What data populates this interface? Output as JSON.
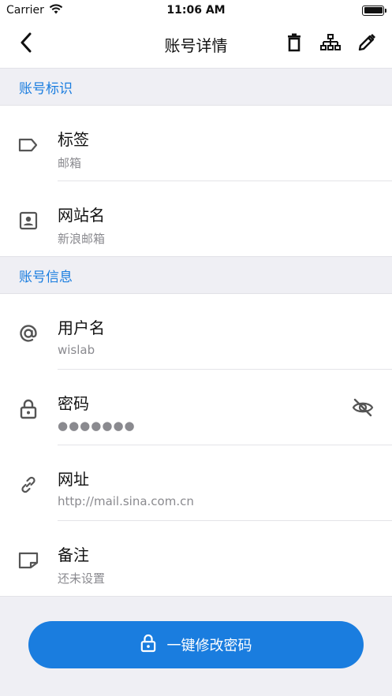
{
  "status_bar": {
    "carrier": "Carrier",
    "time": "11:06 AM"
  },
  "nav": {
    "title": "账号详情",
    "icons": [
      "back-icon",
      "trash-icon",
      "hierarchy-icon",
      "edit-icon"
    ]
  },
  "sections": {
    "identity": "账号标识",
    "info": "账号信息"
  },
  "rows": {
    "tag": {
      "title": "标签",
      "value": "邮箱",
      "icon": "tag-icon"
    },
    "site": {
      "title": "网站名",
      "value": "新浪邮箱",
      "icon": "contact-card-icon"
    },
    "username": {
      "title": "用户名",
      "value": "wislab",
      "icon": "at-icon"
    },
    "password": {
      "title": "密码",
      "value": "●●●●●●●",
      "icon": "lock-icon",
      "toggle_icon": "eye-off-icon"
    },
    "url": {
      "title": "网址",
      "value": "http://mail.sina.com.cn",
      "icon": "link-icon"
    },
    "note": {
      "title": "备注",
      "value": "还未设置",
      "icon": "note-icon"
    }
  },
  "action": {
    "label": "一键修改密码",
    "icon": "lock-icon"
  },
  "colors": {
    "accent": "#1a7ddf",
    "section_bg": "#efeff4",
    "secondary_text": "#8a8a8f"
  }
}
